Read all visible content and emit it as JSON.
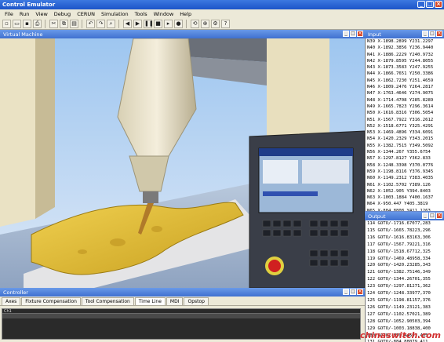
{
  "window": {
    "title": "Control Emulator"
  },
  "menu": [
    "File",
    "Run",
    "View",
    "Debug",
    "CERUN",
    "Simulation",
    "Tools",
    "Window",
    "Help"
  ],
  "toolbar_icons": [
    "new-icon",
    "open-icon",
    "save-icon",
    "print-icon",
    "cut-icon",
    "copy-icon",
    "paste-icon",
    "undo-icon",
    "redo-icon",
    "find-icon",
    "rewind-icon",
    "play-icon",
    "pause-icon",
    "stop-icon",
    "step-icon",
    "record-icon",
    "reset-icon",
    "zoom-icon",
    "settings-icon",
    "help-icon"
  ],
  "panels": {
    "virtual_machine": "Virtual Machine",
    "input": "Input",
    "output": "Output",
    "controller": "Controller"
  },
  "controller_tabs": [
    "Axes",
    "Fixture Compensation",
    "Tool Compensation",
    "Time Line",
    "MDI",
    "Opstop"
  ],
  "active_tab": "Time Line",
  "input_lines": [
    "N39 X-1898.2899 Y231.2297",
    "N40 X-1892.3856 Y236.9440",
    "N41 X-1886.2229 Y240.9732",
    "N42 X-1879.8595 Y244.8055",
    "N43 X-1873.3583 Y247.9255",
    "N44 X-1866.7651 Y250.3386",
    "N45 X-1862.7230 Y251.4659",
    "N46 X-1809.2476 Y264.2817",
    "N47 X-1763.4646 Y274.9075",
    "N48 X-1714.4708 Y285.8289",
    "N49 X-1665.7823 Y296.3614",
    "N50 X-1616.8316 Y306.5054",
    "N51 X-1567.7922 Y316.2612",
    "N52 X-1518.6771 Y325.4291",
    "N53 X-1469.4896 Y334.6091",
    "N54 X-1420.2329 Y343.2015",
    "N55 X-1382.7515 Y349.5092",
    "N56 X-1344.267 Y355.6754",
    "N57 X-1297.8127 Y362.833",
    "N58 X-1248.3398 Y370.0776",
    "N59 X-1198.8116 Y376.9345",
    "N60 X-1149.2312 Y383.4035",
    "N61 X-1102.5702 Y389.126",
    "N62 X-1052.905 Y394.8403",
    "N63 X-1003.1884 Y400.1637",
    "N64 X-950.447 Y405.3819",
    "N65 X-884.8808 Y411.1263",
    "N66 X-824.8778 Y415.8822",
    "N67 X-772.0063 Y419.6574"
  ],
  "output_lines": [
    "114  GOTO/-1716.67077,283",
    "115  GOTO/-1665.78223,296",
    "116  GOTO/-1616.83163,306",
    "117  GOTO/-1567.79221,316",
    "118  GOTO/-1518.67712,325",
    "119  GOTO/-1469.48958,334",
    "120  GOTO/-1420.23285,343",
    "121  GOTO/-1382.75146,349",
    "122  GOTO/-1344.26701,355",
    "123  GOTO/-1297.81271,362",
    "124  GOTO/-1248.33977,370",
    "125  GOTO/-1198.81157,376",
    "126  GOTO/-1149.23121,383",
    "127  GOTO/-1102.57021,389",
    "128  GOTO/-1052.90503,394",
    "129  GOTO/-1003.18838,400",
    "130  GOTO/-950.44697,405",
    "131  GOTO/-884.88079,411",
    "132  GOTO/-824.87776,415"
  ],
  "timeline": {
    "label": "Ch1"
  },
  "watermark": "chinaswitch.com"
}
